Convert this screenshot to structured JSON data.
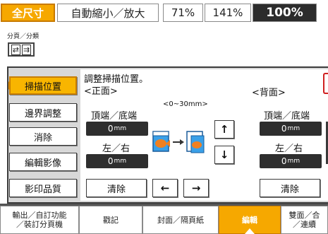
{
  "zoom_bar": {
    "full_size": "全尺寸",
    "auto_zoom": "自動縮小／放大",
    "preset1": "71%",
    "preset2": "141%",
    "preset3": "100%"
  },
  "sort": {
    "label": "分頁／分類"
  },
  "sidebar": {
    "items": [
      {
        "label": "掃描位置"
      },
      {
        "label": "邊界調整"
      },
      {
        "label": "消除"
      },
      {
        "label": "編輯影像"
      },
      {
        "label": "影印品質"
      }
    ]
  },
  "main": {
    "instruction": "調整掃描位置。",
    "front": {
      "title": "<正面>",
      "range": "<0~30mm>",
      "top_bottom_label": "頂端／底端",
      "top_bottom_value": "0",
      "left_right_label": "左／右",
      "left_right_value": "0",
      "unit": "mm",
      "clear": "清除"
    },
    "back": {
      "title": "<背面>",
      "top_bottom_label": "頂端／底端",
      "top_bottom_value": "0",
      "left_right_label": "左／右",
      "left_right_value": "0",
      "unit": "mm",
      "clear": "清除"
    },
    "arrows": {
      "up": "↑",
      "down": "↓",
      "left": "←",
      "right": "→"
    }
  },
  "tabs": [
    {
      "label": "輸出／自訂功能\n／裝訂分頁機"
    },
    {
      "label": "戳記"
    },
    {
      "label": "封面／隔頁紙"
    },
    {
      "label": "編輯"
    },
    {
      "label": "雙面／合\n／連續"
    }
  ],
  "colors": {
    "accent": "#f6a800",
    "dark": "#2e2e2e"
  }
}
